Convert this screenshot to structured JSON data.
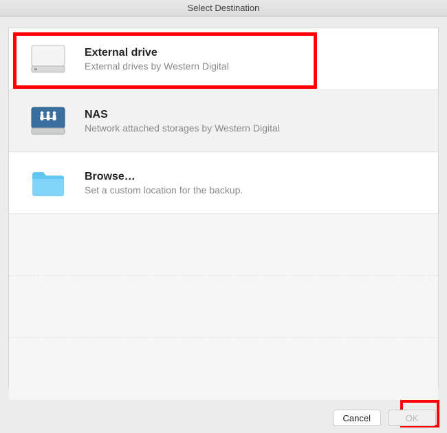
{
  "titlebar": "Select Destination",
  "items": [
    {
      "title": "External drive",
      "subtitle": "External drives by Western Digital"
    },
    {
      "title": "NAS",
      "subtitle": "Network attached storages by Western Digital"
    },
    {
      "title": "Browse…",
      "subtitle": "Set a custom location for the backup."
    }
  ],
  "buttons": {
    "cancel": "Cancel",
    "ok": "OK"
  }
}
